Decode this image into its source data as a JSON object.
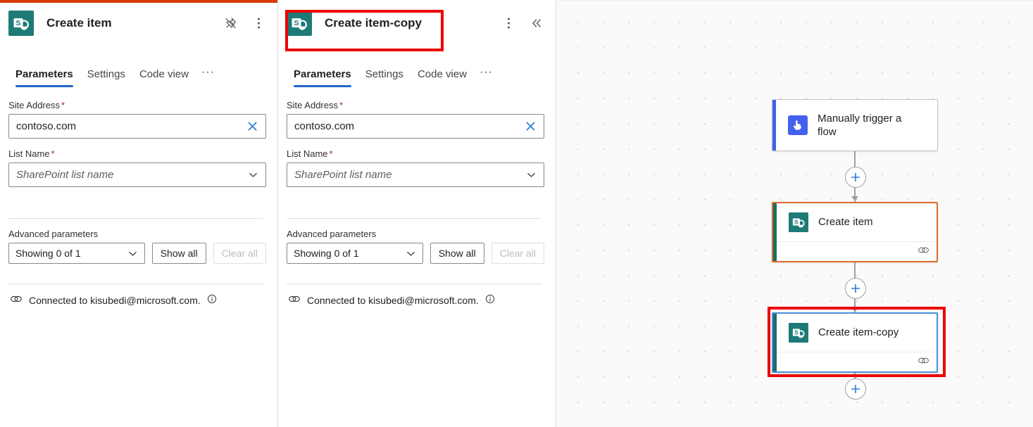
{
  "panels": [
    {
      "id": "create-item",
      "accent_color": "#d83b01",
      "icon_name": "sharepoint-icon",
      "title": "Create item",
      "actions": [
        {
          "name": "unpin-icon",
          "label": "Unpin"
        },
        {
          "name": "more-options-icon",
          "label": "More commands"
        }
      ],
      "tabs": [
        {
          "label": "Parameters",
          "active": true
        },
        {
          "label": "Settings",
          "active": false
        },
        {
          "label": "Code view",
          "active": false
        }
      ],
      "tab_overflow": "···",
      "fields": [
        {
          "label": "Site Address",
          "required": "*",
          "value": "contoso.com",
          "control": "text",
          "clear_icon": "close-icon"
        },
        {
          "label": "List Name",
          "required": "*",
          "placeholder": "SharePoint list name",
          "control": "dropdown",
          "chevron_icon": "chevron-down-icon"
        }
      ],
      "advanced": {
        "label": "Advanced parameters",
        "select_value": "Showing 0 of 1",
        "show_all_label": "Show all",
        "clear_all_label": "Clear all",
        "clear_all_disabled": true
      },
      "connection": {
        "icon": "link-icon",
        "text": "Connected to kisubedi@microsoft.com.",
        "info_icon": "info-icon"
      }
    },
    {
      "id": "create-item-copy",
      "accent_color": "transparent",
      "icon_name": "sharepoint-icon",
      "title": "Create item-copy",
      "actions": [
        {
          "name": "more-options-icon",
          "label": "More commands"
        },
        {
          "name": "collapse-icon",
          "label": "Collapse"
        }
      ],
      "tabs": [
        {
          "label": "Parameters",
          "active": true
        },
        {
          "label": "Settings",
          "active": false
        },
        {
          "label": "Code view",
          "active": false
        }
      ],
      "tab_overflow": "···",
      "fields": [
        {
          "label": "Site Address",
          "required": "*",
          "value": "contoso.com",
          "control": "text",
          "clear_icon": "close-icon"
        },
        {
          "label": "List Name",
          "required": "*",
          "placeholder": "SharePoint list name",
          "control": "dropdown",
          "chevron_icon": "chevron-down-icon"
        }
      ],
      "advanced": {
        "label": "Advanced parameters",
        "select_value": "Showing 0 of 1",
        "show_all_label": "Show all",
        "clear_all_label": "Clear all",
        "clear_all_disabled": true
      },
      "connection": {
        "icon": "link-icon",
        "text": "Connected to kisubedi@microsoft.com.",
        "info_icon": "info-icon"
      }
    }
  ],
  "canvas": {
    "nodes": [
      {
        "id": "manually-trigger-a-flow",
        "label": "Manually trigger a flow",
        "icon": "manual-trigger-icon",
        "accent": "#4361ee",
        "state": "normal"
      },
      {
        "id": "create-item",
        "label": "Create item",
        "icon": "sharepoint-icon",
        "accent": "#186e6a",
        "state": "selected-orange",
        "footer_icon": "link-icon"
      },
      {
        "id": "create-item-copy",
        "label": "Create item-copy",
        "icon": "sharepoint-icon",
        "accent": "#186e6a",
        "state": "selected-blue",
        "footer_icon": "link-icon"
      }
    ],
    "add_buttons": [
      {
        "name": "add-step-button-1",
        "label": "+"
      },
      {
        "name": "add-step-button-2",
        "label": "+"
      },
      {
        "name": "add-step-button-3",
        "label": "+"
      }
    ]
  },
  "annotations": [
    {
      "name": "highlight-panel-header",
      "target": "create-item-copy panel header",
      "color": "#ee0000"
    },
    {
      "name": "highlight-flow-node",
      "target": "Create item-copy node",
      "color": "#ee0000"
    }
  ]
}
